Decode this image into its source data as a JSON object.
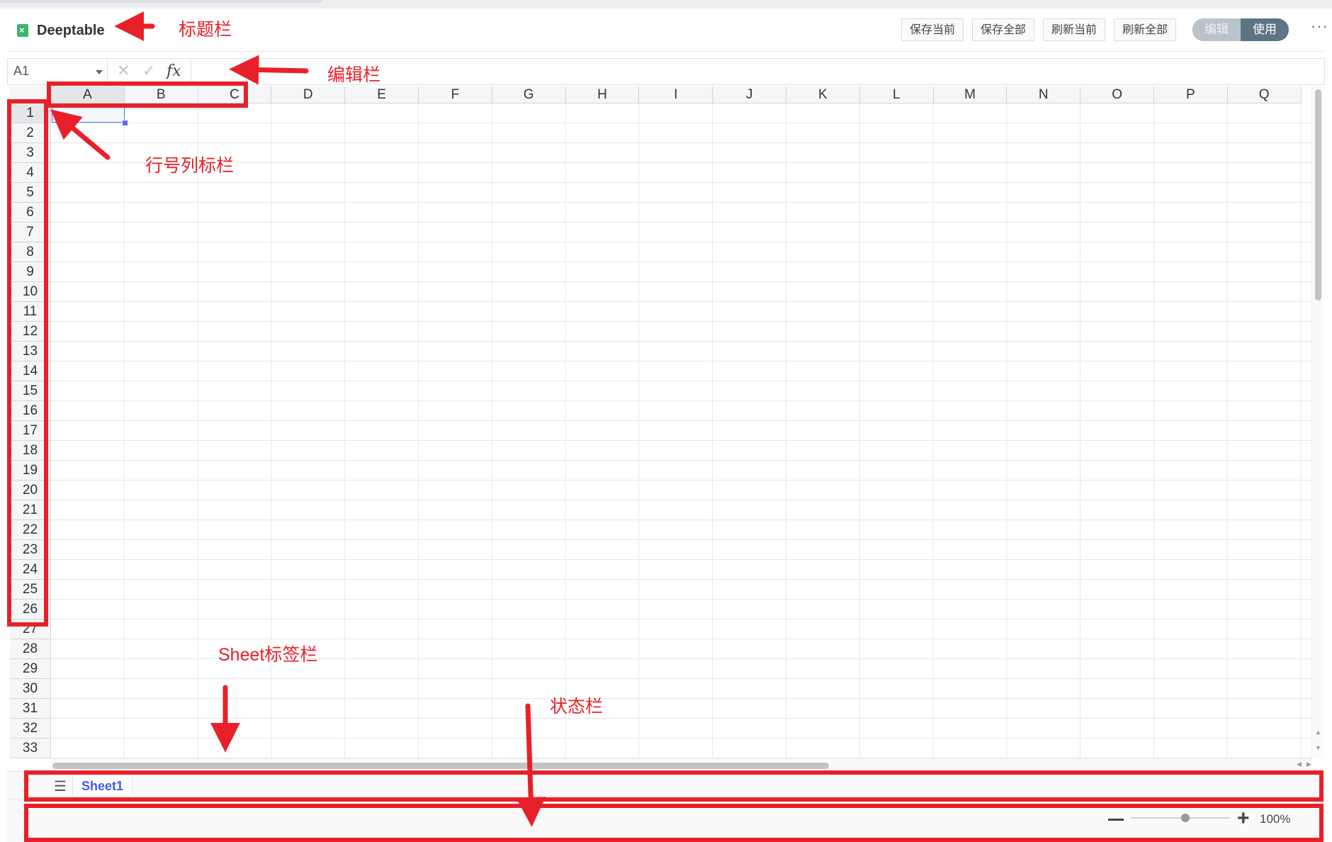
{
  "title_bar": {
    "app_name": "Deeptable",
    "buttons": [
      "保存当前",
      "保存全部",
      "刷新当前",
      "刷新全部"
    ],
    "mode_toggle": {
      "edit_label": "编辑",
      "use_label": "使用",
      "active": "使用"
    },
    "more_icon": "more-dots-icon"
  },
  "formula_bar": {
    "cell_ref": "A1",
    "cancel_icon": "close-icon",
    "confirm_icon": "check-icon",
    "fx_label": "fx",
    "formula_value": ""
  },
  "grid": {
    "columns": [
      "A",
      "B",
      "C",
      "D",
      "E",
      "F",
      "G",
      "H",
      "I",
      "J",
      "K",
      "L",
      "M",
      "N",
      "O",
      "P",
      "Q"
    ],
    "rows": [
      "1",
      "2",
      "3",
      "4",
      "5",
      "6",
      "7",
      "8",
      "9",
      "10",
      "11",
      "12",
      "13",
      "14",
      "15",
      "16",
      "17",
      "18",
      "19",
      "20",
      "21",
      "22",
      "23",
      "24",
      "25",
      "26",
      "27",
      "28",
      "29",
      "30",
      "31",
      "32",
      "33"
    ],
    "selected_cell": "A1"
  },
  "sheet_bar": {
    "menu_icon": "hamburger-icon",
    "tabs": [
      "Sheet1"
    ],
    "active_tab": "Sheet1"
  },
  "status_bar": {
    "zoom": "100%",
    "zoom_level": 1.0
  },
  "annotations": {
    "title_bar": "标题栏",
    "edit_bar": "编辑栏",
    "row_col_header": "行号列标栏",
    "sheet_tab_bar": "Sheet标签栏",
    "status_bar": "状态栏"
  },
  "colors": {
    "accent": "#4458f0",
    "annotation": "#e8202a",
    "toggle_active": "#5c7585",
    "app_icon": "#3cb46e"
  }
}
